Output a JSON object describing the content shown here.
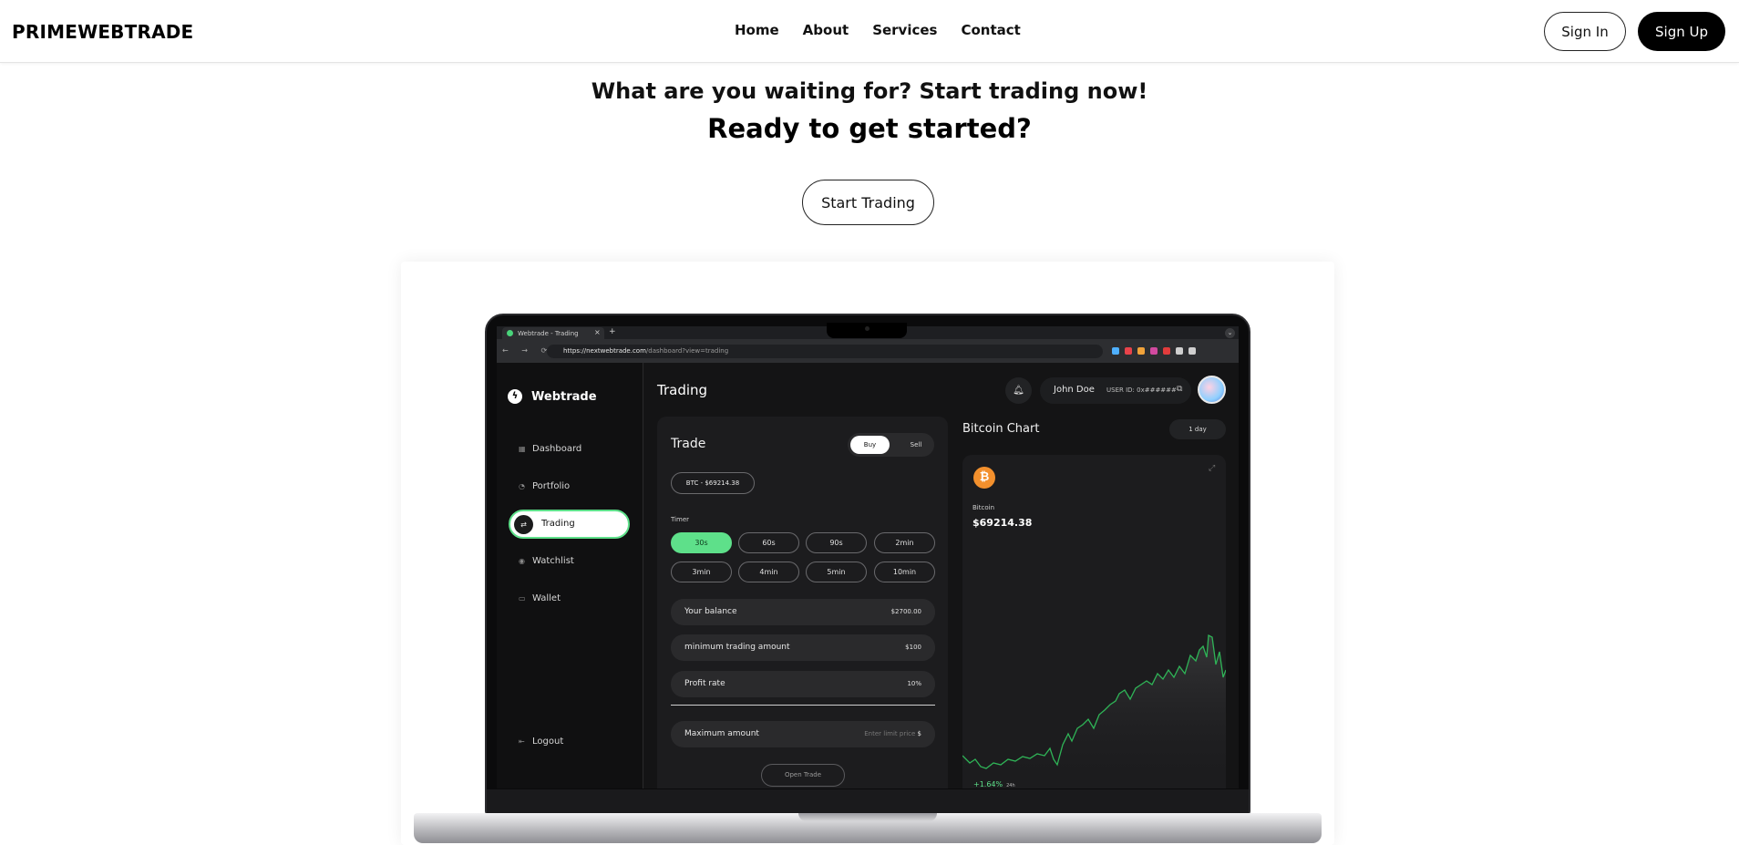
{
  "nav": {
    "brand": "PRIMEWEBTRADE",
    "links": [
      "Home",
      "About",
      "Services",
      "Contact"
    ],
    "sign_in": "Sign In",
    "sign_up": "Sign Up"
  },
  "hero": {
    "subtitle": "What are you waiting for? Start trading now!",
    "title": "Ready to get started?",
    "cta": "Start Trading"
  },
  "mockup": {
    "browser": {
      "tab_title": "Webtrade - Trading",
      "tab_close": "×",
      "tab_add": "+",
      "nav_buttons": "← → ⟳",
      "url_host": "https://nextwebtrade.com",
      "url_path": "/dashboard?view=trading"
    },
    "app": {
      "logo": "Webtrade",
      "sidebar": [
        "Dashboard",
        "Portfolio",
        "Trading",
        "Watchlist",
        "Wallet"
      ],
      "active_item": "Trading",
      "logout": "Logout",
      "page_title": "Trading",
      "user_name": "John Doe",
      "user_id": "USER ID: 0x######"
    },
    "trade": {
      "title": "Trade",
      "buy": "Buy",
      "sell": "Sell",
      "pair": "BTC - $69214.38",
      "timer_label": "Timer",
      "timers": [
        "30s",
        "60s",
        "90s",
        "2min",
        "3min",
        "4min",
        "5min",
        "10min"
      ],
      "selected_timer": "30s",
      "balance_label": "Your balance",
      "balance_value": "$2700.00",
      "min_label": "minimum trading amount",
      "min_value": "$100",
      "profit_label": "Profit rate",
      "profit_value": "10%",
      "max_label": "Maximum amount",
      "max_placeholder": "Enter limit price",
      "max_currency": "$",
      "open_trade": "Open Trade"
    },
    "chart": {
      "title": "Bitcoin Chart",
      "range": "1 day",
      "coin": "Bitcoin",
      "price": "$69214.38",
      "change": "+1.64%",
      "change_period": "24h"
    }
  },
  "colors": {
    "accent_green": "#5ee08a",
    "bitcoin_orange": "#f3902d",
    "primary_black": "#000000"
  }
}
